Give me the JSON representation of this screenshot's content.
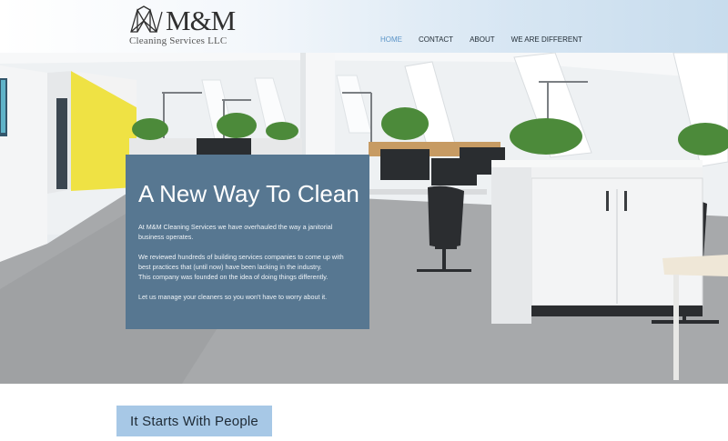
{
  "brand": {
    "name": "M&M",
    "subtitle": "Cleaning Services LLC",
    "logo_icon": "geometric-mm-mark-icon"
  },
  "nav": {
    "items": [
      {
        "label": "HOME",
        "active": true
      },
      {
        "label": "CONTACT",
        "active": false
      },
      {
        "label": "ABOUT",
        "active": false
      },
      {
        "label": "WE ARE DIFFERENT",
        "active": false
      }
    ],
    "active_color": "#5b95c8"
  },
  "hero": {
    "image": "modern-office-interior",
    "title": "A New Way To Clean",
    "paragraphs": [
      "At M&M Cleaning Services we have overhauled the way a janitorial",
      "business operates.",
      "We reviewed hundreds of building services companies to come up with",
      "best practices that (until now) have been lacking in the industry.",
      "This company was founded on the idea of doing things differently.",
      "Let us manage your cleaners so you won't have to worry about it."
    ],
    "panel_color": "#577791"
  },
  "section": {
    "heading": "It Starts With People",
    "tab_color": "#a7c8e6"
  }
}
